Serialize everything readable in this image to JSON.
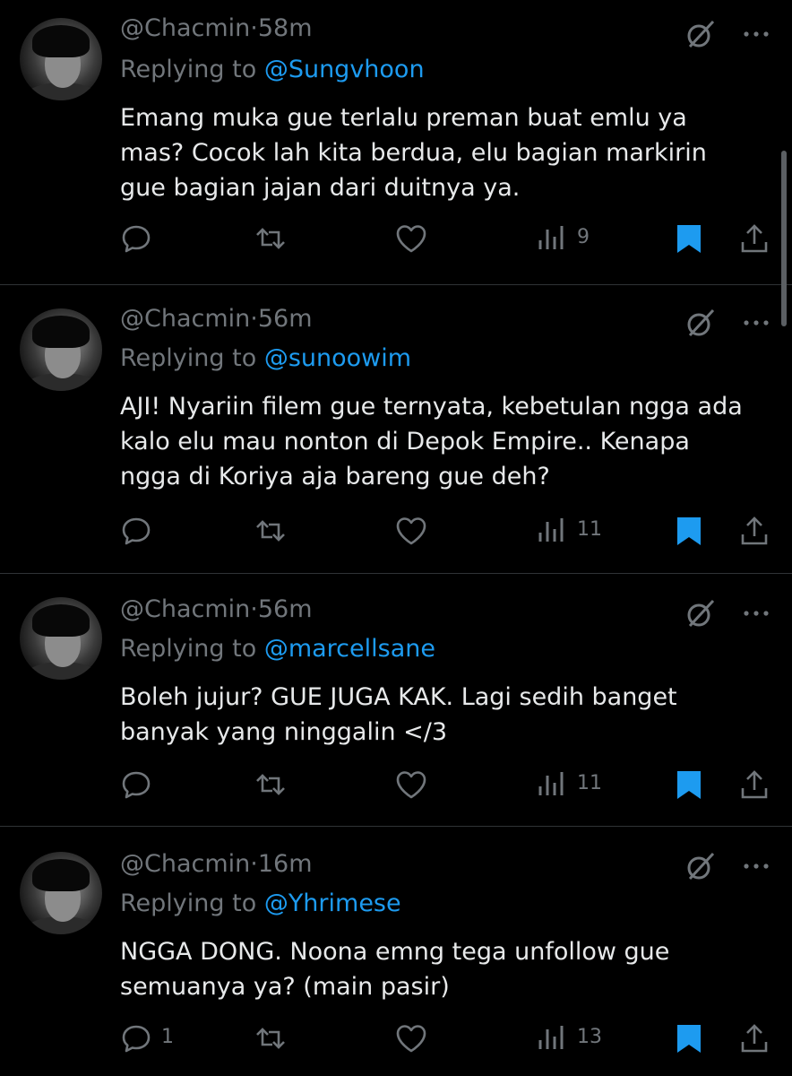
{
  "tweets": [
    {
      "username": "@Chacmin",
      "time": "58m",
      "replying_prefix": "Replying to",
      "reply_to": "@Sungvhoon",
      "text": "Emang muka gue terlalu preman buat emlu ya mas? Cocok lah kita berdua, elu bagian markirin gue bagian jajan dari duitnya ya.",
      "reply_count": "",
      "view_count": "9"
    },
    {
      "username": "@Chacmin",
      "time": "56m",
      "replying_prefix": "Replying to",
      "reply_to": "@sunoowim",
      "text": "AJI! Nyariin filem gue ternyata, kebetulan ngga ada kalo elu mau nonton di Depok Empire.. Kenapa ngga di Koriya aja bareng gue deh?",
      "reply_count": "",
      "view_count": "11"
    },
    {
      "username": "@Chacmin",
      "time": "56m",
      "replying_prefix": "Replying to",
      "reply_to": "@marcellsane",
      "text": "Boleh jujur? GUE JUGA KAK. Lagi sedih banget banyak yang ninggalin </3",
      "reply_count": "",
      "view_count": "11"
    },
    {
      "username": "@Chacmin",
      "time": "16m",
      "replying_prefix": "Replying to",
      "reply_to": "@Yhrimese",
      "text": "NGGA DONG. Noona emng tega unfollow gue semuanya ya? (main pasir)",
      "reply_count": "1",
      "view_count": "13"
    }
  ],
  "separator": "·",
  "icons": [
    "grok-icon",
    "more-icon",
    "reply-icon",
    "retweet-icon",
    "like-icon",
    "views-icon",
    "bookmark-icon",
    "share-icon"
  ],
  "colors": {
    "background": "#000000",
    "text": "#e7e9ea",
    "muted": "#71767b",
    "link": "#1d9bf0",
    "bookmark": "#1d9bf0",
    "divider": "#2f3336"
  }
}
